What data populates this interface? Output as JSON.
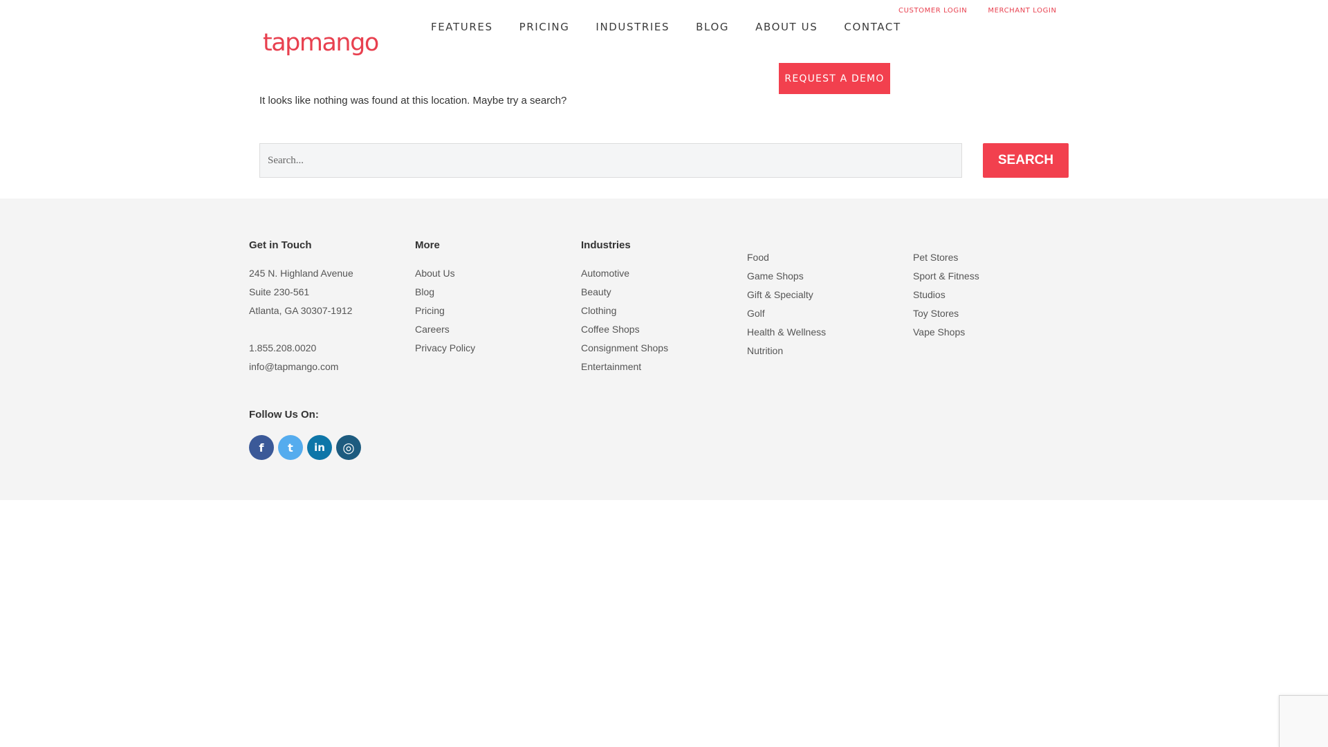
{
  "colors": {
    "brand": "#f2404e",
    "footer_bg": "#f4f4f4"
  },
  "header": {
    "logo_text": "tapmango",
    "top_links": [
      "CUSTOMER LOGIN",
      "MERCHANT LOGIN"
    ],
    "nav": [
      "FEATURES",
      "PRICING",
      "INDUSTRIES",
      "BLOG",
      "ABOUT US",
      "CONTACT"
    ],
    "demo_label": "REQUEST A DEMO"
  },
  "main": {
    "message": "It looks like nothing was found at this location. Maybe try a search?",
    "search_placeholder": "Search...",
    "search_button": "SEARCH"
  },
  "footer": {
    "contact": {
      "title": "Get in Touch",
      "address": [
        "245 N. Highland Avenue",
        "Suite 230-561",
        "Atlanta, GA 30307-1912"
      ],
      "phone": "1.855.208.0020",
      "email": "info@tapmango.com"
    },
    "more": {
      "title": "More",
      "items": [
        "About Us",
        "Blog",
        "Pricing",
        "Careers",
        "Privacy Policy"
      ]
    },
    "industries": {
      "title": "Industries",
      "col1": [
        "Automotive",
        "Beauty",
        "Clothing",
        "Coffee Shops",
        "Consignment Shops",
        "Entertainment"
      ],
      "col2": [
        "Food",
        "Game Shops",
        "Gift & Specialty",
        "Golf",
        "Health & Wellness",
        "Nutrition"
      ],
      "col3": [
        "Pet Stores",
        "Sport & Fitness",
        "Studios",
        "Toy Stores",
        "Vape Shops"
      ]
    },
    "follow_title": "Follow Us On:",
    "socials": [
      {
        "icon": "facebook-icon",
        "glyph": "f",
        "color": "#3b5998"
      },
      {
        "icon": "twitter-icon",
        "glyph": "t",
        "color": "#55acee"
      },
      {
        "icon": "linkedin-icon",
        "glyph": "in",
        "color": "#0e76a8"
      },
      {
        "icon": "instagram-icon",
        "glyph": "◎",
        "color": "#1d5b7f"
      }
    ]
  }
}
